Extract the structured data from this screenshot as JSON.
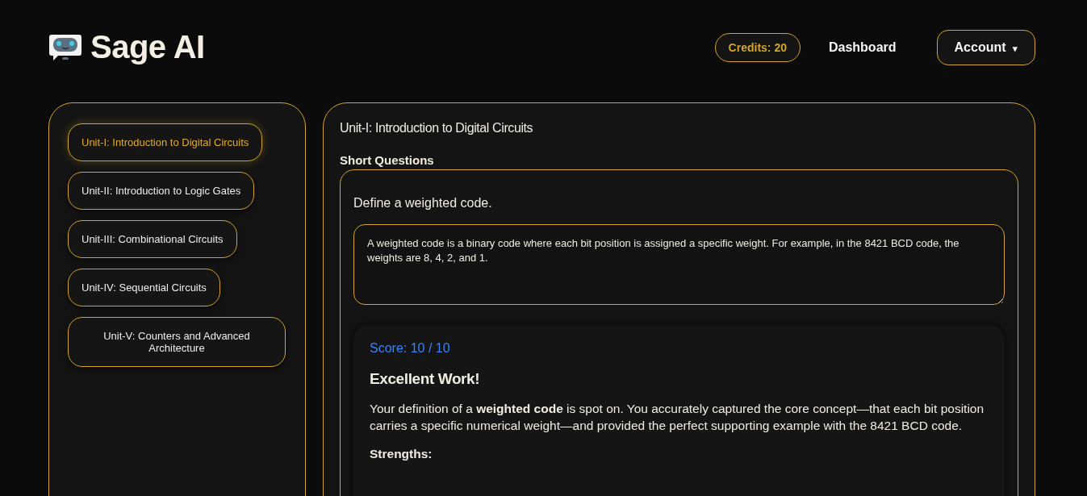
{
  "header": {
    "brand": "Sage AI",
    "credits": "Credits: 20",
    "nav_link": "Dashboard",
    "account_button": "Account",
    "account_caret": "▾"
  },
  "units": [
    {
      "label": "Unit-I: Introduction to Digital Circuits",
      "selected": true
    },
    {
      "label": "Unit-II: Introduction to Logic Gates",
      "selected": false
    },
    {
      "label": "Unit-III: Combinational Circuits",
      "selected": false
    },
    {
      "label": "Unit-IV: Sequential Circuits",
      "selected": false
    },
    {
      "label": "Unit-V: Counters and Advanced Architecture",
      "selected": false
    }
  ],
  "main": {
    "unit_title": "Unit-I: Introduction to Digital Circuits",
    "section_title": "Short Questions",
    "question": {
      "text": "Define a weighted code.",
      "answer": "A weighted code is a binary code where each bit position is assigned a specific weight. For example, in the 8421 BCD code, the weights are 8, 4, 2, and 1.",
      "feedback": {
        "score": "Score: 10 / 10",
        "heading": "Excellent Work!",
        "body": "Your definition of a **weighted code** is spot on. You accurately captured the core concept—that each bit position carries a specific numerical weight—and provided the perfect supporting example with the 8421 BCD code.",
        "subheading": "Strengths:"
      }
    }
  }
}
